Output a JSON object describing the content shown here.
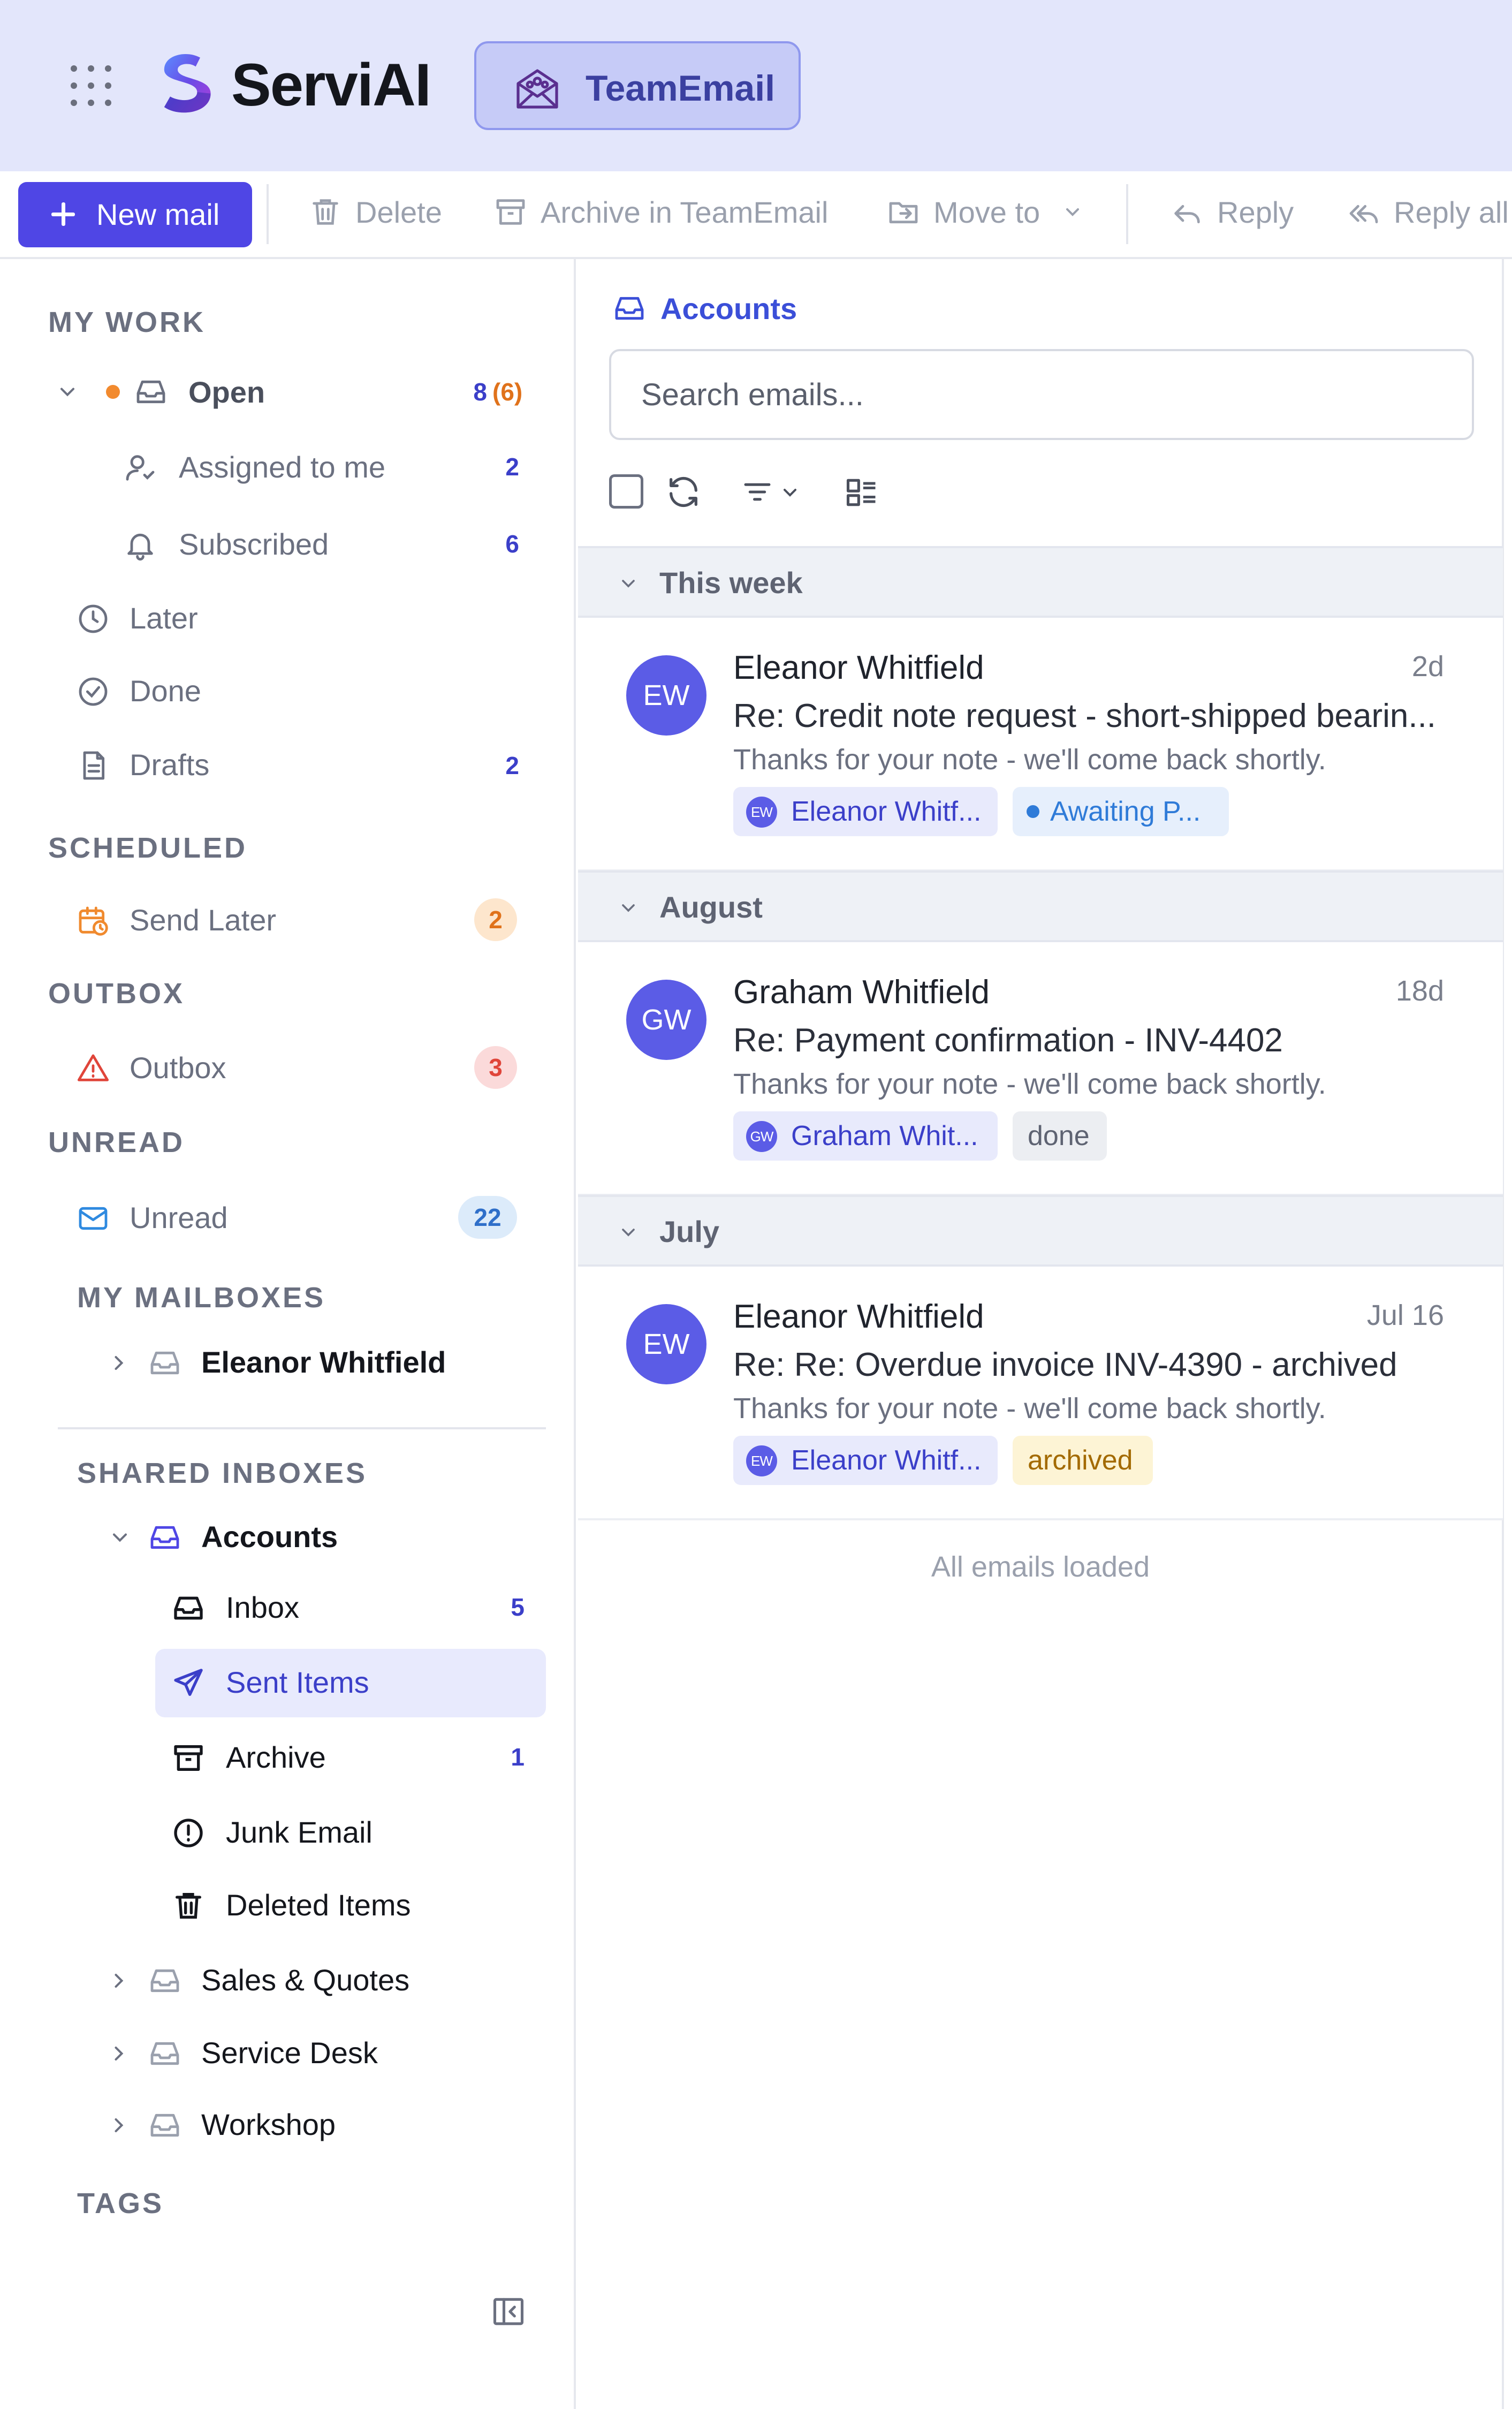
{
  "header": {
    "brand": "ServiAI",
    "product": "TeamEmail",
    "colors": {
      "header_bg": "#e3e6fb",
      "accent": "#4f46e5",
      "chip_bg": "#c6cbf7"
    }
  },
  "toolbar": {
    "new_mail": "New mail",
    "delete": "Delete",
    "archive": "Archive in TeamEmail",
    "move_to": "Move to",
    "reply": "Reply",
    "reply_all": "Reply all"
  },
  "sidebar": {
    "my_work": {
      "title": "MY WORK",
      "open": {
        "label": "Open",
        "count": "8",
        "count_secondary": "(6)"
      },
      "assigned": {
        "label": "Assigned to me",
        "count": "2"
      },
      "subscribed": {
        "label": "Subscribed",
        "count": "6"
      },
      "later": {
        "label": "Later"
      },
      "done": {
        "label": "Done"
      },
      "drafts": {
        "label": "Drafts",
        "count": "2"
      }
    },
    "scheduled": {
      "title": "SCHEDULED",
      "send_later": {
        "label": "Send Later",
        "count": "2"
      }
    },
    "outbox": {
      "title": "OUTBOX",
      "outbox": {
        "label": "Outbox",
        "count": "3"
      }
    },
    "unread": {
      "title": "UNREAD",
      "unread": {
        "label": "Unread",
        "count": "22"
      }
    },
    "my_mailboxes": {
      "title": "MY MAILBOXES",
      "items": [
        {
          "label": "Eleanor Whitfield"
        }
      ]
    },
    "shared_inboxes": {
      "title": "SHARED INBOXES",
      "accounts": {
        "label": "Accounts",
        "folders": [
          {
            "label": "Inbox",
            "count": "5",
            "icon": "inbox-icon"
          },
          {
            "label": "Sent Items",
            "count": "",
            "icon": "send-icon",
            "selected": true
          },
          {
            "label": "Archive",
            "count": "1",
            "icon": "archive-icon"
          },
          {
            "label": "Junk Email",
            "count": "",
            "icon": "alert-circle-icon"
          },
          {
            "label": "Deleted Items",
            "count": "",
            "icon": "trash-icon"
          }
        ]
      },
      "others": [
        {
          "label": "Sales & Quotes"
        },
        {
          "label": "Service Desk"
        },
        {
          "label": "Workshop"
        }
      ]
    },
    "tags": {
      "title": "TAGS"
    }
  },
  "main": {
    "breadcrumb": "Accounts",
    "search_placeholder": "Search emails...",
    "groups": [
      {
        "label": "This week",
        "emails": [
          {
            "initials": "EW",
            "sender": "Eleanor Whitfield",
            "age": "2d",
            "subject": "Re: Credit note request - short-shipped bearin...",
            "preview": "Thanks for your note - we'll come back shortly.",
            "assignee": "Eleanor Whitf...",
            "status": "Awaiting P..."
          }
        ]
      },
      {
        "label": "August",
        "emails": [
          {
            "initials": "GW",
            "sender": "Graham Whitfield",
            "age": "18d",
            "subject": "Re: Payment confirmation - INV-4402",
            "preview": "Thanks for your note - we'll come back shortly.",
            "assignee": "Graham Whit...",
            "status": "done"
          }
        ]
      },
      {
        "label": "July",
        "emails": [
          {
            "initials": "EW",
            "sender": "Eleanor Whitfield",
            "age": "Jul 16",
            "subject": "Re: Re: Overdue invoice INV-4390 - archived",
            "preview": "Thanks for your note - we'll come back shortly.",
            "assignee": "Eleanor Whitf...",
            "status": "archived"
          }
        ]
      }
    ],
    "end_note": "All emails loaded"
  }
}
